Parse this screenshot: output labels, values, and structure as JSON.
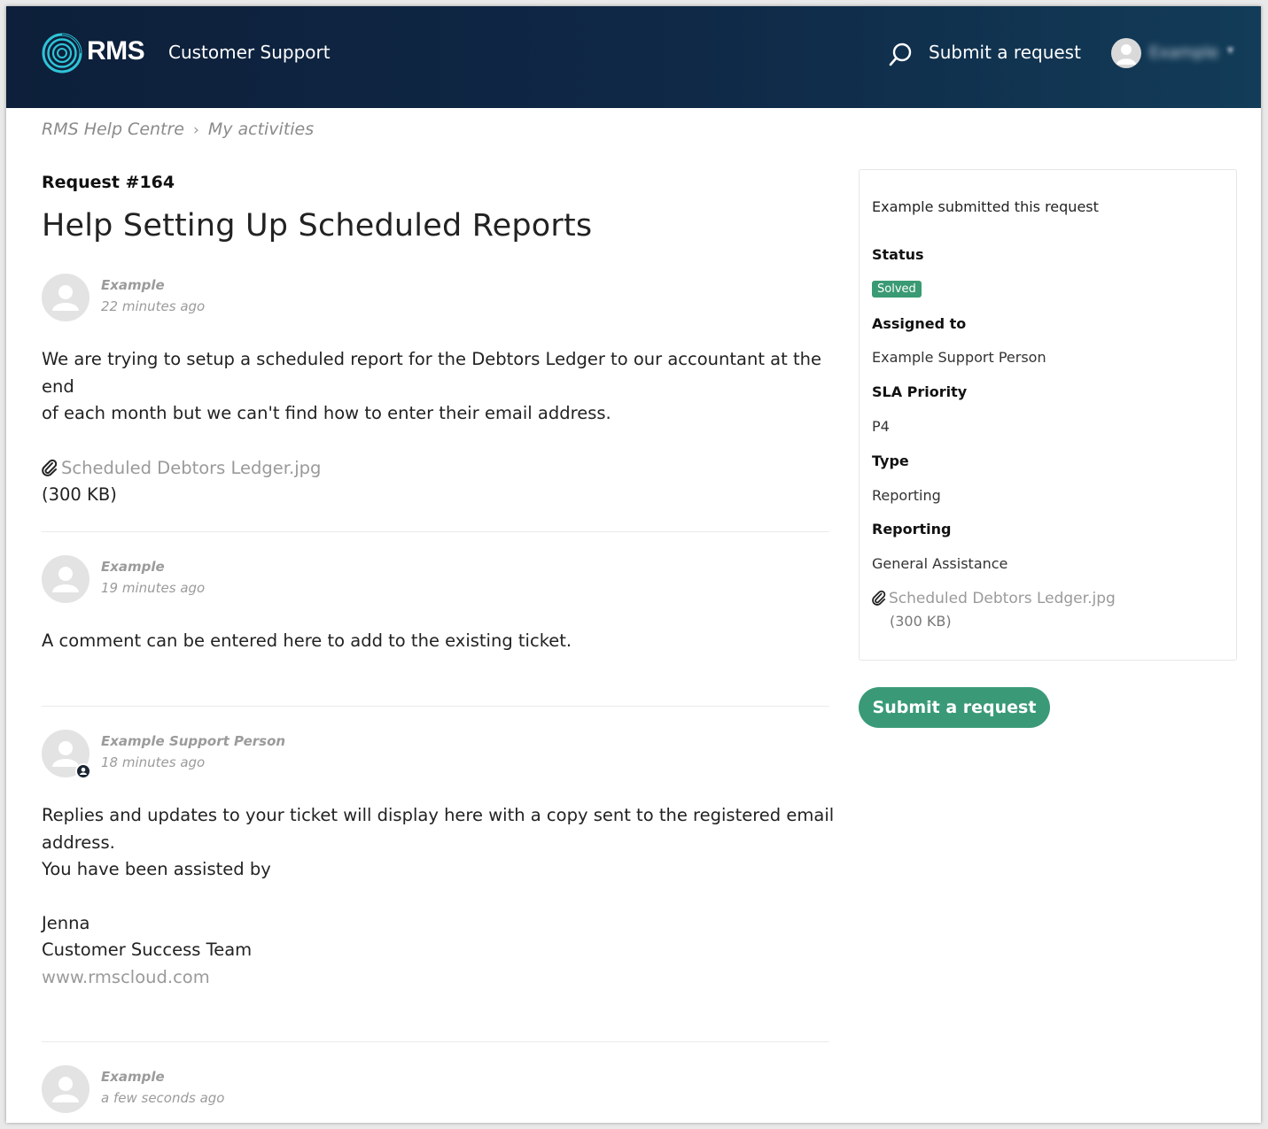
{
  "header": {
    "brand": "RMS",
    "title": "Customer Support",
    "submit_label": "Submit a request",
    "user_name": "Example",
    "caret": "▾"
  },
  "breadcrumb": {
    "home": "RMS Help Centre",
    "separator": "›",
    "current": "My activities"
  },
  "request": {
    "number_label": "Request #164",
    "title": "Help Setting Up Scheduled Reports"
  },
  "comments": [
    {
      "author": "Example",
      "time": "22 minutes ago",
      "body_lines": [
        "We are trying to setup a scheduled report for the Debtors Ledger to our accountant at the end",
        "of each month but we can't find how to enter their email address."
      ],
      "attachment_name": "Scheduled Debtors Ledger.jpg",
      "attachment_size": "(300 KB)"
    },
    {
      "author": "Example",
      "time": "19 minutes ago",
      "body_lines": [
        "A comment can be entered here to add to the existing ticket."
      ]
    },
    {
      "author": "Example Support Person",
      "time": "18 minutes ago",
      "is_agent": true,
      "body_lines": [
        "Replies and updates to your ticket will display here with a copy sent to the registered email",
        "address.",
        "You have been assisted by",
        "",
        "Jenna",
        "Customer Success Team"
      ],
      "link": "www.rmscloud.com"
    },
    {
      "author": "Example",
      "time": "a few seconds ago"
    }
  ],
  "sidebar": {
    "submitted_text": "Example submitted this request",
    "status_label": "Status",
    "status_value": "Solved",
    "assigned_label": "Assigned to",
    "assigned_value": "Example Support Person",
    "sla_label": "SLA Priority",
    "sla_value": "P4",
    "type_label": "Type",
    "type_value": "Reporting",
    "reporting_label": "Reporting",
    "reporting_value": "General Assistance",
    "attachment_name": "Scheduled Debtors Ledger.jpg",
    "attachment_size": "(300 KB)"
  },
  "submit_button_label": "Submit a request",
  "colors": {
    "header_bg": "#0f2947",
    "accent_green": "#3a9a78",
    "solved_badge": "#3a9a73",
    "logo_cyan": "#2ec4d6"
  },
  "icons": [
    "rms-logo-icon",
    "search-icon",
    "avatar-icon",
    "paperclip-icon",
    "agent-badge-icon"
  ]
}
